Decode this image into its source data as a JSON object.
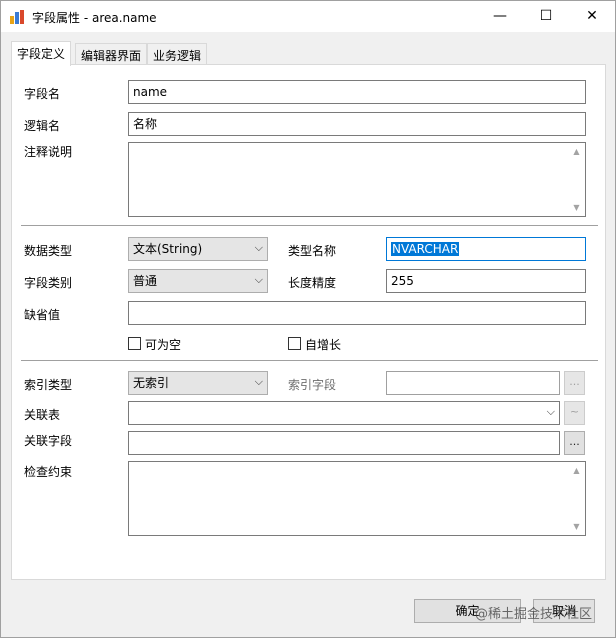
{
  "window": {
    "title": "字段属性 - area.name",
    "minimize": "—",
    "maximize": "☐",
    "close": "✕"
  },
  "tabs": [
    {
      "label": "字段定义",
      "active": true
    },
    {
      "label": "编辑器界面",
      "active": false
    },
    {
      "label": "业务逻辑",
      "active": false
    }
  ],
  "form": {
    "field_name_label": "字段名",
    "field_name_value": "name",
    "logic_name_label": "逻辑名",
    "logic_name_value": "名称",
    "comment_label": "注释说明",
    "comment_value": "",
    "data_type_label": "数据类型",
    "data_type_value": "文本(String)",
    "type_name_label": "类型名称",
    "type_name_value": "NVARCHAR",
    "field_category_label": "字段类别",
    "field_category_value": "普通",
    "length_label": "长度精度",
    "length_value": "255",
    "default_label": "缺省值",
    "default_value": "",
    "nullable_label": "可为空",
    "nullable_checked": false,
    "autoinc_label": "自增长",
    "autoinc_checked": false,
    "index_type_label": "索引类型",
    "index_type_value": "无索引",
    "index_field_label": "索引字段",
    "index_field_value": "",
    "index_field_btn": "...",
    "rel_table_label": "关联表",
    "rel_table_value": "",
    "rel_table_btn": "~",
    "rel_field_label": "关联字段",
    "rel_field_value": "",
    "rel_field_btn": "...",
    "check_label": "检查约束",
    "check_value": ""
  },
  "buttons": {
    "ok": "确定",
    "cancel": "取消"
  },
  "watermark": "@稀土掘金技术社区",
  "colors": {
    "selection": "#0078d7",
    "panel": "#ffffff",
    "window": "#f0f0f0"
  }
}
